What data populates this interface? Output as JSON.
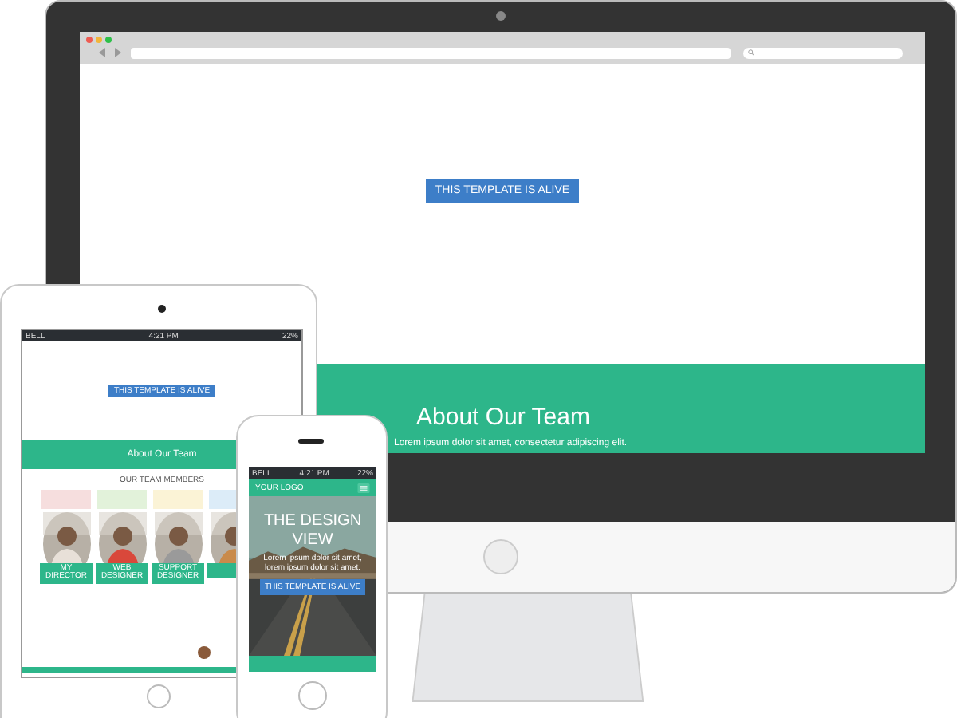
{
  "desktop": {
    "button": "THIS TEMPLATE IS ALIVE",
    "section_title": "About Our Team",
    "section_text": "Lorem ipsum dolor sit amet, consectetur adipiscing elit."
  },
  "tablet": {
    "status_bar": {
      "carrier": "BELL",
      "time": "4:21 PM",
      "battery": "22%"
    },
    "button": "THIS TEMPLATE IS ALIVE",
    "section_title": "About Our Team",
    "team_heading": "OUR TEAM MEMBERS",
    "members": [
      {
        "role": "MY DIRECTOR",
        "color": "#f6dede"
      },
      {
        "role": "WEB DESIGNER",
        "color": "#e2f2da"
      },
      {
        "role": "SUPPORT DESIGNER",
        "color": "#fbf3d6"
      },
      {
        "color": "#dcecf8"
      }
    ]
  },
  "phone": {
    "status_bar": {
      "carrier": "BELL",
      "time": "4:21 PM",
      "battery": "22%"
    },
    "logo": "YOUR LOGO",
    "hero_title": "THE DESIGN VIEW",
    "hero_text": "Lorem ipsum dolor sit amet, lorem ipsum dolor sit amet.",
    "button": "THIS TEMPLATE IS ALIVE"
  }
}
